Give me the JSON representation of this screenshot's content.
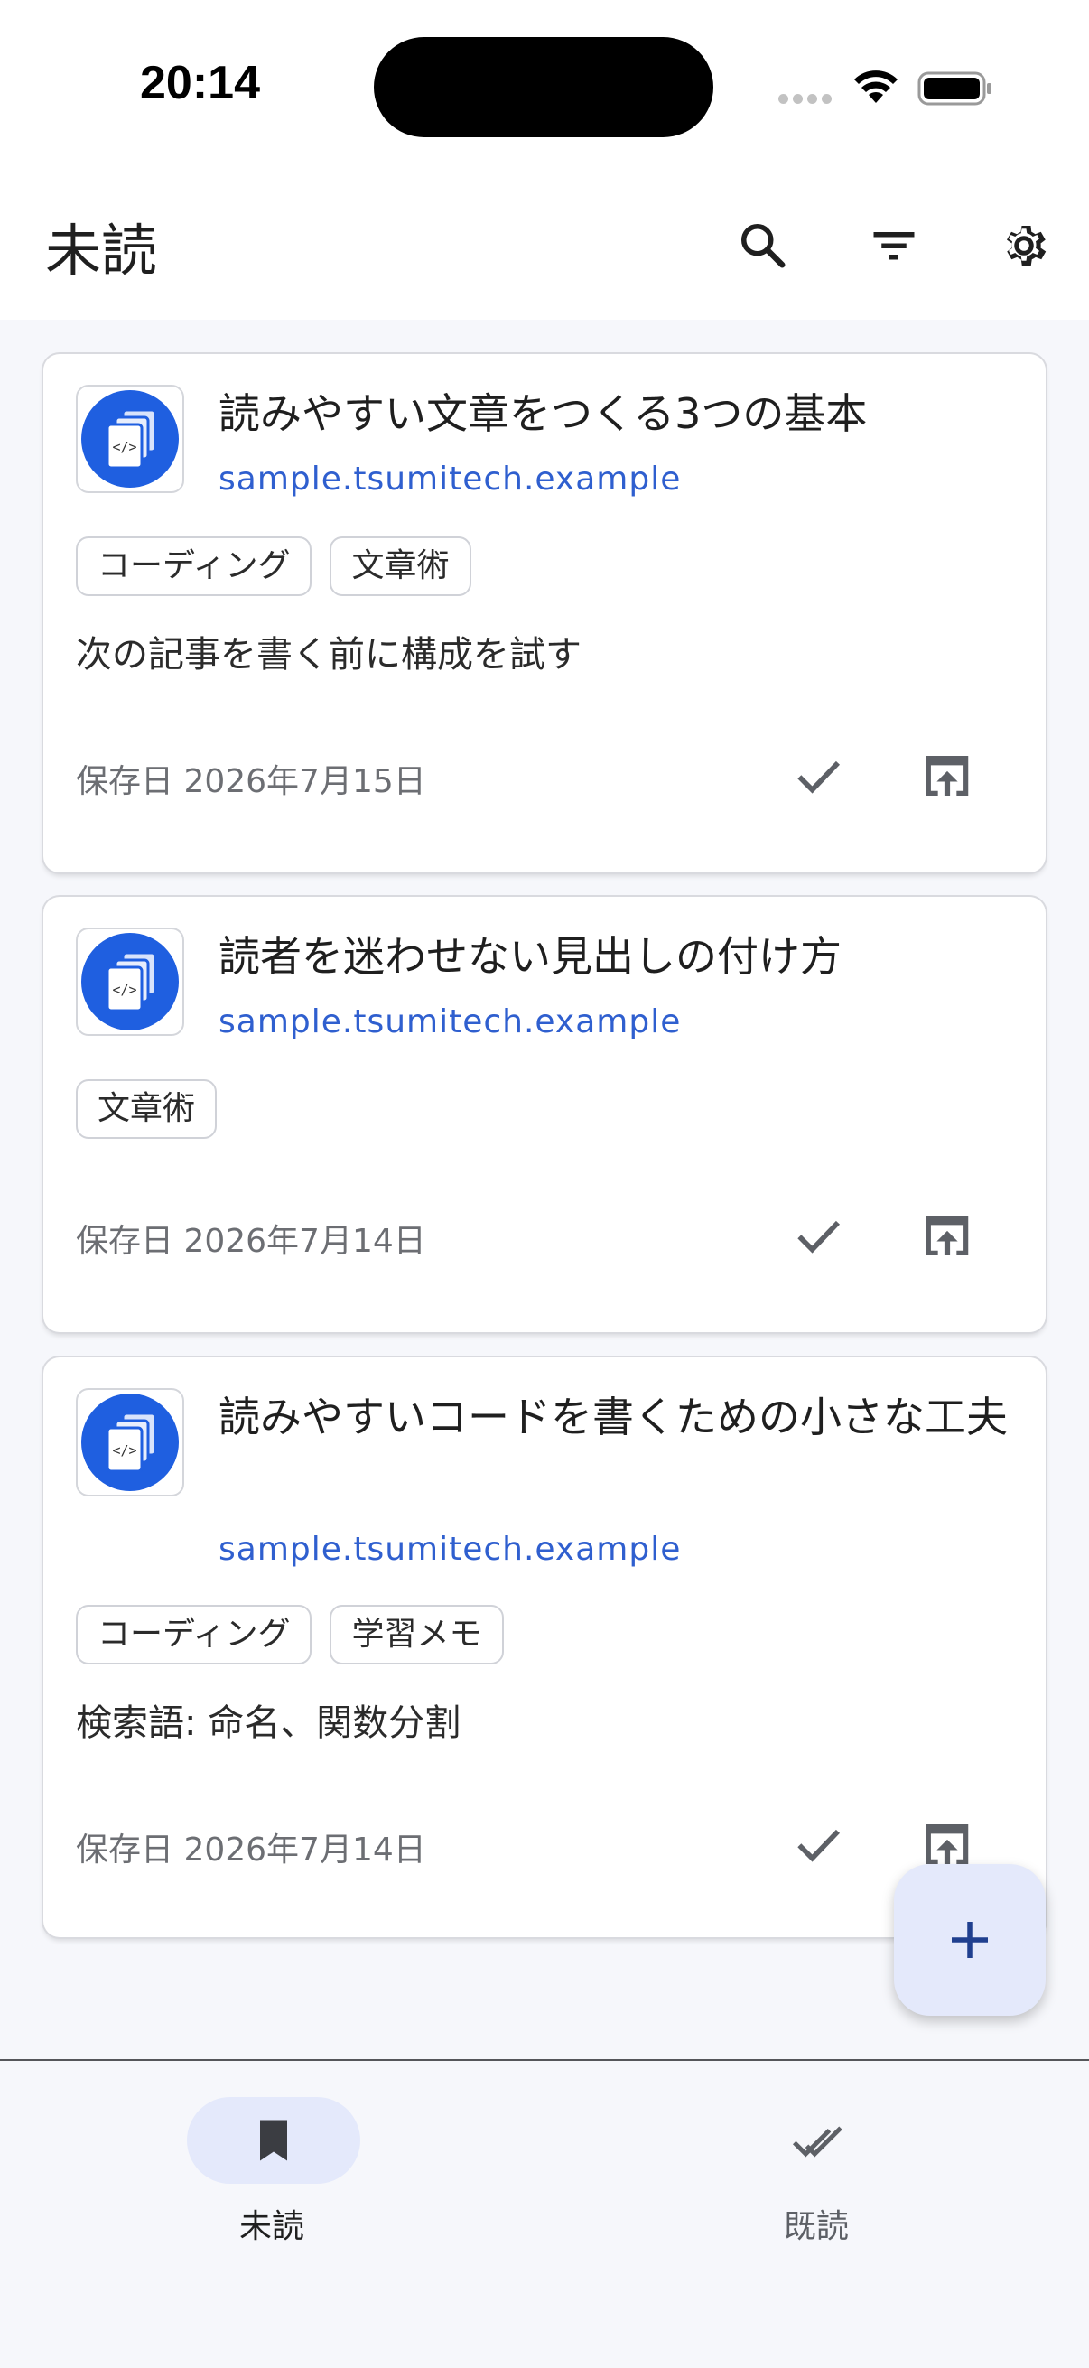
{
  "status_bar": {
    "time": "20:14"
  },
  "app_bar": {
    "title": "未読",
    "actions": [
      "search-icon",
      "filter-icon",
      "gear-icon"
    ]
  },
  "articles": [
    {
      "title": "読みやすい文章をつくる3つの基本",
      "domain": "sample.tsumitech.example",
      "tags": [
        "コーディング",
        "文章術"
      ],
      "note": "次の記事を書く前に構成を試す",
      "saved": "保存日 2026年7月15日"
    },
    {
      "title": "読者を迷わせない見出しの付け方",
      "domain": "sample.tsumitech.example",
      "tags": [
        "文章術"
      ],
      "note": "",
      "saved": "保存日 2026年7月14日"
    },
    {
      "title": "読みやすいコードを書くための小さな工夫",
      "domain": "sample.tsumitech.example",
      "tags": [
        "コーディング",
        "学習メモ"
      ],
      "note": "検索語: 命名、関数分割",
      "saved": "保存日 2026年7月14日"
    }
  ],
  "bottom_nav": {
    "items": [
      {
        "label": "未読",
        "icon": "bookmark-icon",
        "active": true
      },
      {
        "label": "既読",
        "icon": "double-check-icon",
        "active": false
      }
    ]
  },
  "colors": {
    "accent_link": "#2f5fcf",
    "favicon_blue": "#1f5fe0",
    "fab_bg": "#e4e9fb",
    "nav_active_pill": "#e4e9fb"
  }
}
